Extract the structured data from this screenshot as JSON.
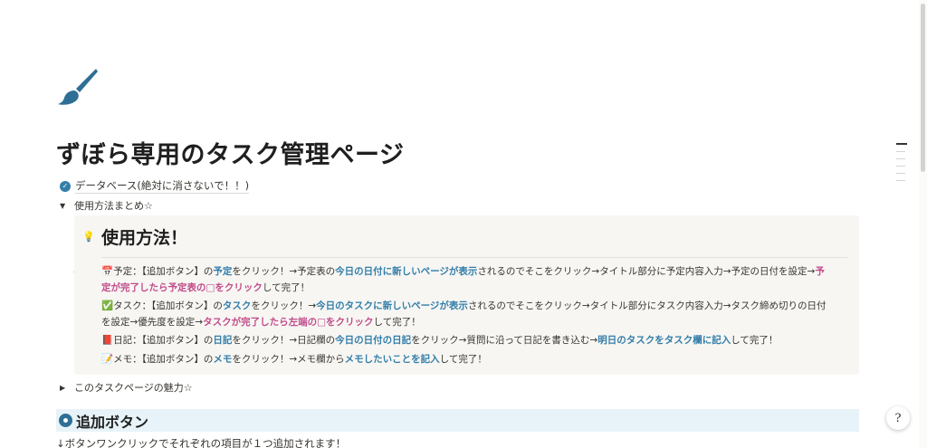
{
  "page": {
    "icon": "paintbrush-icon",
    "title": "ずぼら専用のタスク管理ページ"
  },
  "database_link": {
    "icon": "check-circle-icon",
    "label": "データベース(絶対に消さないで！！)"
  },
  "toggle_usage": {
    "label": "使用方法まとめ☆",
    "expanded": true
  },
  "callout": {
    "icon": "lightbulb-icon",
    "heading": "使用方法！",
    "lines": [
      {
        "emoji": "📅",
        "parts": [
          {
            "t": "予定：",
            "s": "b"
          },
          {
            "t": "【追加ボタン】の",
            "s": ""
          },
          {
            "t": "予定",
            "s": "blue"
          },
          {
            "t": "をクリック！→予定表の",
            "s": ""
          },
          {
            "t": "今日の日付に新しいページが表示",
            "s": "blue"
          },
          {
            "t": "されるのでそこをクリック→タイトル部分に予定内容入力→予定の日付を設定→",
            "s": ""
          },
          {
            "t": "予",
            "s": "pink"
          }
        ]
      },
      {
        "emoji": "",
        "parts": [
          {
            "t": "定が完了したら予定表の□をクリック",
            "s": "pink"
          },
          {
            "t": "して完了！",
            "s": ""
          }
        ]
      },
      {
        "emoji": "✅",
        "parts": [
          {
            "t": "タスク：",
            "s": "b"
          },
          {
            "t": "【追加ボタン】の",
            "s": ""
          },
          {
            "t": "タスク",
            "s": "blue"
          },
          {
            "t": "をクリック！→",
            "s": ""
          },
          {
            "t": "今日のタスクに新しいページが表示",
            "s": "blue"
          },
          {
            "t": "されるのでそこをクリック→タイトル部分にタスク内容入力→タスク締め切りの日付",
            "s": ""
          }
        ]
      },
      {
        "emoji": "",
        "parts": [
          {
            "t": "を設定→優先度を設定→",
            "s": ""
          },
          {
            "t": "タスクが完了したら左端の□をクリック",
            "s": "pink"
          },
          {
            "t": "して完了！",
            "s": ""
          }
        ]
      },
      {
        "emoji": "📕",
        "parts": [
          {
            "t": "日記：",
            "s": "b"
          },
          {
            "t": "【追加ボタン】の",
            "s": ""
          },
          {
            "t": "日記",
            "s": "blue"
          },
          {
            "t": "をクリック！→日記欄の",
            "s": ""
          },
          {
            "t": "今日の日付の日記",
            "s": "blue"
          },
          {
            "t": "をクリック→質問に沿って日記を書き込む→",
            "s": ""
          },
          {
            "t": "明日のタスクをタスク欄に記入",
            "s": "blue"
          },
          {
            "t": "して完了！",
            "s": ""
          }
        ]
      },
      {
        "emoji": "📝",
        "parts": [
          {
            "t": "メモ：",
            "s": "b"
          },
          {
            "t": "【追加ボタン】の",
            "s": ""
          },
          {
            "t": "メモ",
            "s": "blue"
          },
          {
            "t": "をクリック！→メモ欄から",
            "s": ""
          },
          {
            "t": "メモしたいことを記入",
            "s": "blue"
          },
          {
            "t": "して完了！",
            "s": ""
          }
        ]
      }
    ]
  },
  "toggle_charm": {
    "label": "このタスクページの魅力☆",
    "expanded": false
  },
  "section_add": {
    "icon": "record-circle-icon",
    "label": "追加ボタン"
  },
  "body_text": "↓ボタンワンクリックでそれぞれの項目が１つ追加されます！",
  "help_button": {
    "label": "?"
  },
  "colors": {
    "link_blue": "#337ea9",
    "highlight_pink": "#c14c8a",
    "callout_bg": "#f7f6f3",
    "section_bg": "#e7f3f8"
  }
}
